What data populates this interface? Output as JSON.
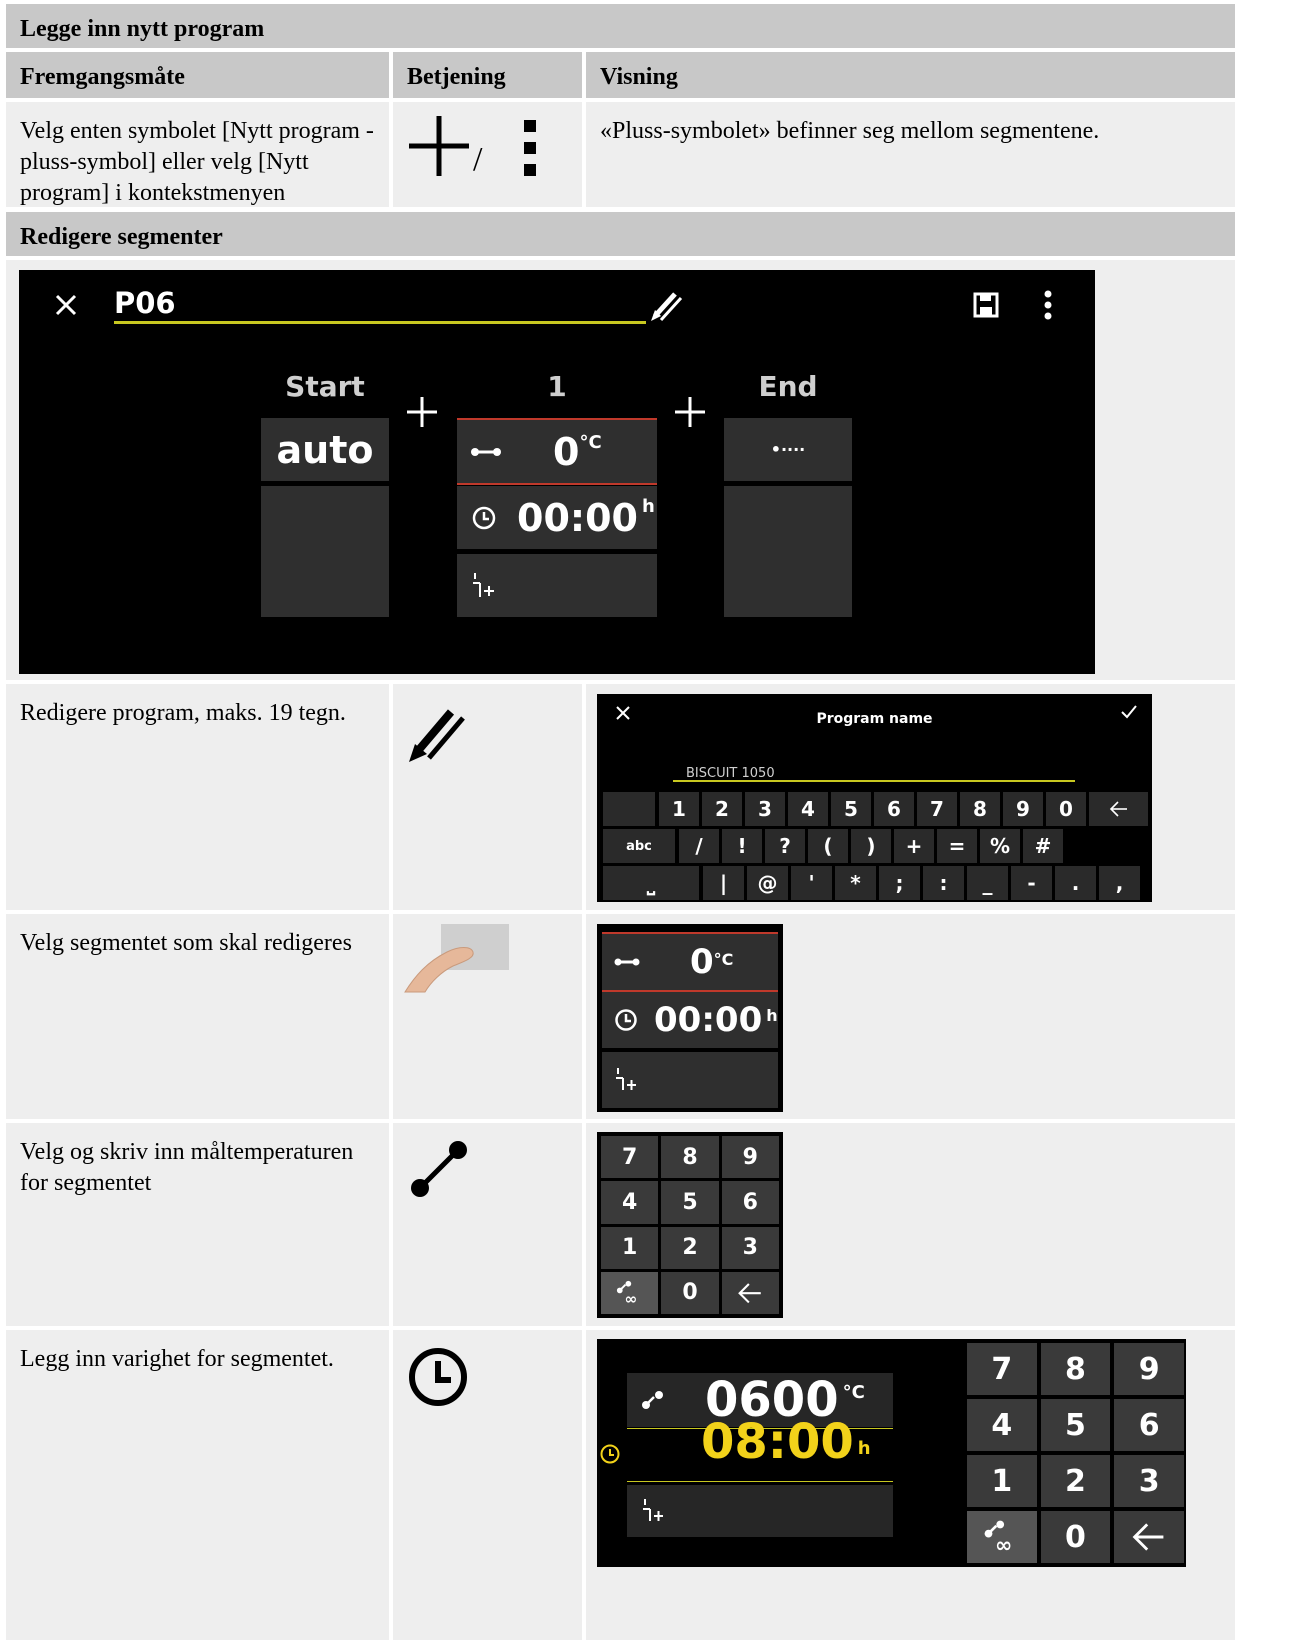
{
  "section1": {
    "title": "Legge inn nytt program",
    "headers": {
      "procedure": "Fremgangsmåte",
      "operation": "Betjening",
      "display": "Visning"
    },
    "row": {
      "procedure": "Velg enten symbolet [Nytt program - pluss-symbol] eller velg [Nytt program] i kontekstmenyen",
      "operation_separator": "/",
      "display": "«Pluss-symbolet» befinner seg mellom segmentene."
    }
  },
  "section2": {
    "title": "Redigere segmenter",
    "editor": {
      "program_name": "P06",
      "columns": [
        {
          "label": "Start",
          "value": "auto"
        },
        {
          "label": "1",
          "temperature": "0",
          "temperature_unit": "°C",
          "time": "00:00",
          "time_unit": "h"
        },
        {
          "label": "End",
          "value": "•····"
        }
      ]
    }
  },
  "rows": [
    {
      "procedure": "Redigere program, maks. 19 tegn.",
      "keyboard": {
        "title": "Program name",
        "value": "BISCUIT 1050",
        "row1": [
          "1",
          "2",
          "3",
          "4",
          "5",
          "6",
          "7",
          "8",
          "9",
          "0"
        ],
        "row2_mode": "abc",
        "row2": [
          "/",
          "!",
          "?",
          "(",
          ")",
          "+",
          "=",
          "%",
          "#"
        ],
        "row3": [
          "|",
          "@",
          "'",
          "*",
          ";",
          ":",
          "_",
          "-",
          ".",
          ","
        ]
      }
    },
    {
      "procedure": "Velg segmentet som skal redigeres",
      "segment": {
        "temperature": "0",
        "temperature_unit": "°C",
        "time": "00:00",
        "time_unit": "h"
      }
    },
    {
      "procedure": "Velg og skriv inn måltemperaturen for segmentet",
      "keypad": [
        "7",
        "8",
        "9",
        "4",
        "5",
        "6",
        "1",
        "2",
        "3",
        "",
        "0",
        ""
      ]
    },
    {
      "procedure": "Legg inn varighet for segmentet.",
      "duration": {
        "temperature": "0600",
        "temperature_unit": "°C",
        "time": "08:00",
        "time_unit": "h",
        "keypad": [
          "7",
          "8",
          "9",
          "4",
          "5",
          "6",
          "1",
          "2",
          "3",
          "",
          "0",
          ""
        ]
      }
    }
  ]
}
